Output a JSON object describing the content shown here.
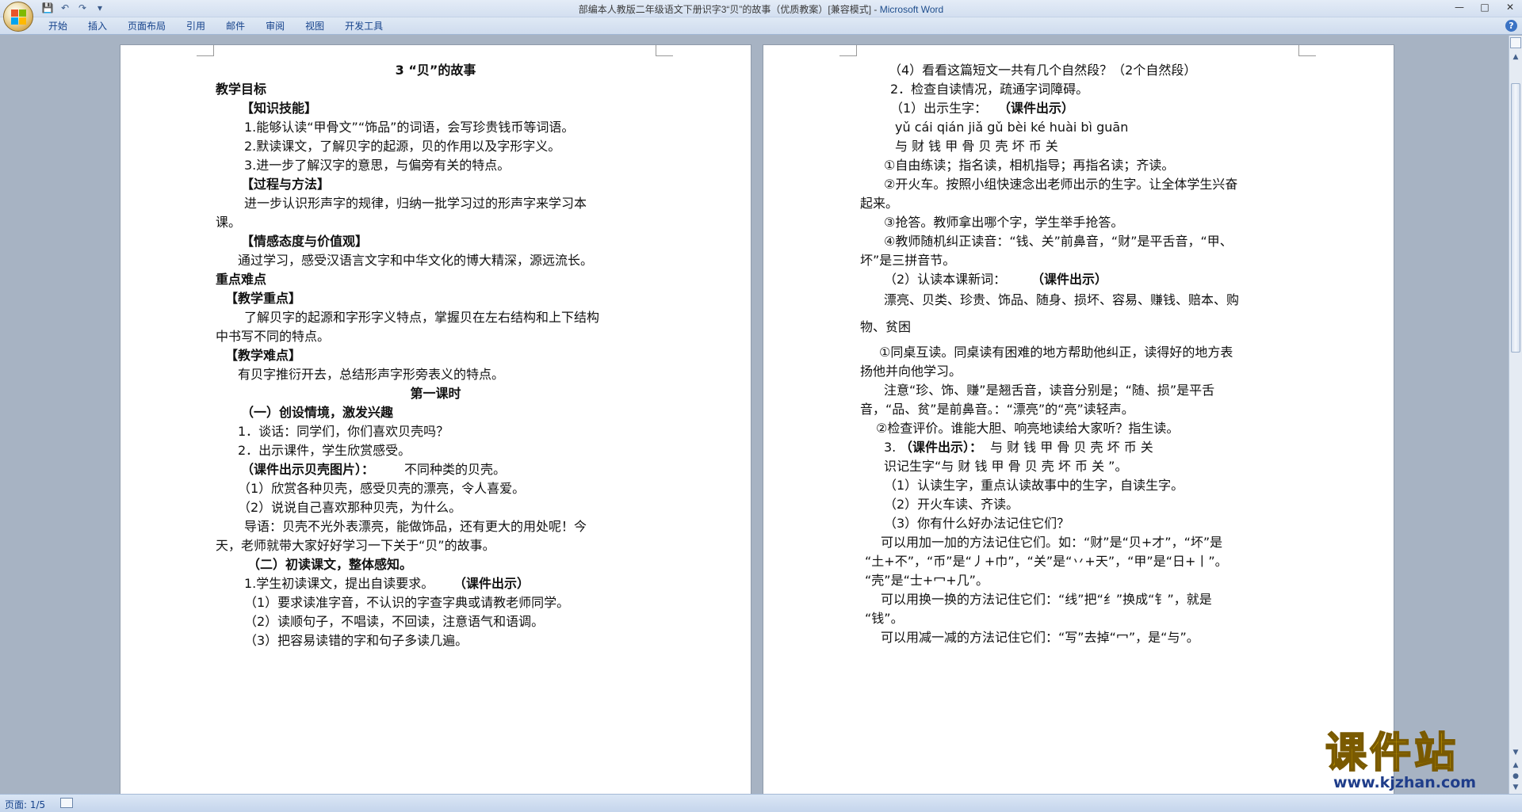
{
  "window": {
    "title_main": "部编本人教版二年级语文下册识字3“贝”的故事（优质教案）[兼容模式] - ",
    "title_app": "Microsoft Word"
  },
  "ribbon": {
    "tabs": [
      "开始",
      "插入",
      "页面布局",
      "引用",
      "邮件",
      "审阅",
      "视图",
      "开发工具"
    ]
  },
  "left_page": {
    "lines": [
      "3 “贝”的故事",
      "教学目标",
      "【知识技能】",
      "1.能够认读“甲骨文”“饰品”的词语，会写珍贵钱币等词语。",
      "2.默读课文，了解贝字的起源，贝的作用以及字形字义。",
      "3.进一步了解汉字的意思，与偏旁有关的特点。",
      "【过程与方法】",
      "进一步认识形声字的规律，归纳一批学习过的形声字来学习本",
      "课。",
      "【情感态度与价值观】",
      "通过学习，感受汉语言文字和中华文化的博大精深，源远流长。",
      "重点难点",
      "【教学重点】",
      "了解贝字的起源和字形字义特点，掌握贝在左右结构和上下结构",
      "中书写不同的特点。",
      "【教学难点】",
      "有贝字推衍开去，总结形声字形旁表义的特点。",
      "第一课时",
      "（一）创设情境，激发兴趣",
      "1．谈话：同学们，你们喜欢贝壳吗？",
      "2．出示课件，学生欣赏感受。",
      "（课件出示贝壳图片）：",
      "不同种类的贝壳。",
      "（1）欣赏各种贝壳，感受贝壳的漂亮，令人喜爱。",
      "（2）说说自己喜欢那种贝壳，为什么。",
      "导语：贝壳不光外表漂亮，能做饰品，还有更大的用处呢！今",
      "天，老师就带大家好好学习一下关于“贝”的故事。",
      "（二）初读课文，整体感知。",
      "1.学生初读课文，提出自读要求。",
      "（课件出示）",
      "（1）要求读准字音，不认识的字查字典或请教老师同学。",
      "（2）读顺句子，不唱读，不回读，注意语气和语调。",
      "（3）把容易读错的字和句子多读几遍。"
    ]
  },
  "right_page": {
    "lines": [
      "（4）看看这篇短文一共有几个自然段？（2个自然段）",
      "2．检查自读情况，疏通字词障碍。",
      "（1）出示生字：",
      "（课件出示）",
      "yǔ cái qián jiǎ gǔ bèi ké huài bì guān",
      "与  财   钱    甲   骨  贝    壳  坏     币  关",
      "①自由练读；指名读，相机指导；再指名读；齐读。",
      "②开火车。按照小组快速念出老师出示的生字。让全体学生兴奋",
      "起来。",
      "③抢答。教师拿出哪个字，学生举手抢答。",
      "④教师随机纠正读音：“钱、关”前鼻音，“财”是平舌音，“甲、",
      "坏”是三拼音节。",
      "（2）认读本课新词：",
      "（课件出示）",
      "漂亮、贝类、珍贵、饰品、随身、损坏、容易、赚钱、赔本、购",
      "物、贫困",
      "①同桌互读。同桌读有困难的地方帮助他纠正，读得好的地方表",
      "扬他并向他学习。",
      "注意“珍、饰、赚”是翘舌音，读音分别是；“随、损”是平舌",
      "音，“品、贫”是前鼻音。：“漂亮”的“亮”读轻声。",
      "②检查评价。谁能大胆、响亮地读给大家听？指生读。",
      "3.",
      "（课件出示）：",
      "与 财    钱     甲    骨  贝     壳  坏     币  关",
      "识记生字“与 财    钱     甲    骨  贝     壳  坏     币  关 ”。",
      "（1）认读生字，重点认读故事中的生字，自读生字。",
      "（2）开火车读、齐读。",
      "（3）你有什么好办法记住它们？",
      "可以用加一加的方法记住它们。如：“财”是“贝+才”，“坏”是",
      "“土+不”，“币”是“丿+巾”，“关”是“丷+天”，“甲”是“日+丨”。",
      "“壳”是“士+冖+几”。",
      "可以用换一换的方法记住它们：“线”把“纟”换成“钅”，就是",
      "“钱”。",
      "可以用减一减的方法记住它们：“写”去掉“冖”，是“与”。"
    ]
  },
  "status": {
    "page_label": "页面: 1/5"
  },
  "watermark": {
    "text": "课件站",
    "url": "www.kjzhan.com"
  }
}
